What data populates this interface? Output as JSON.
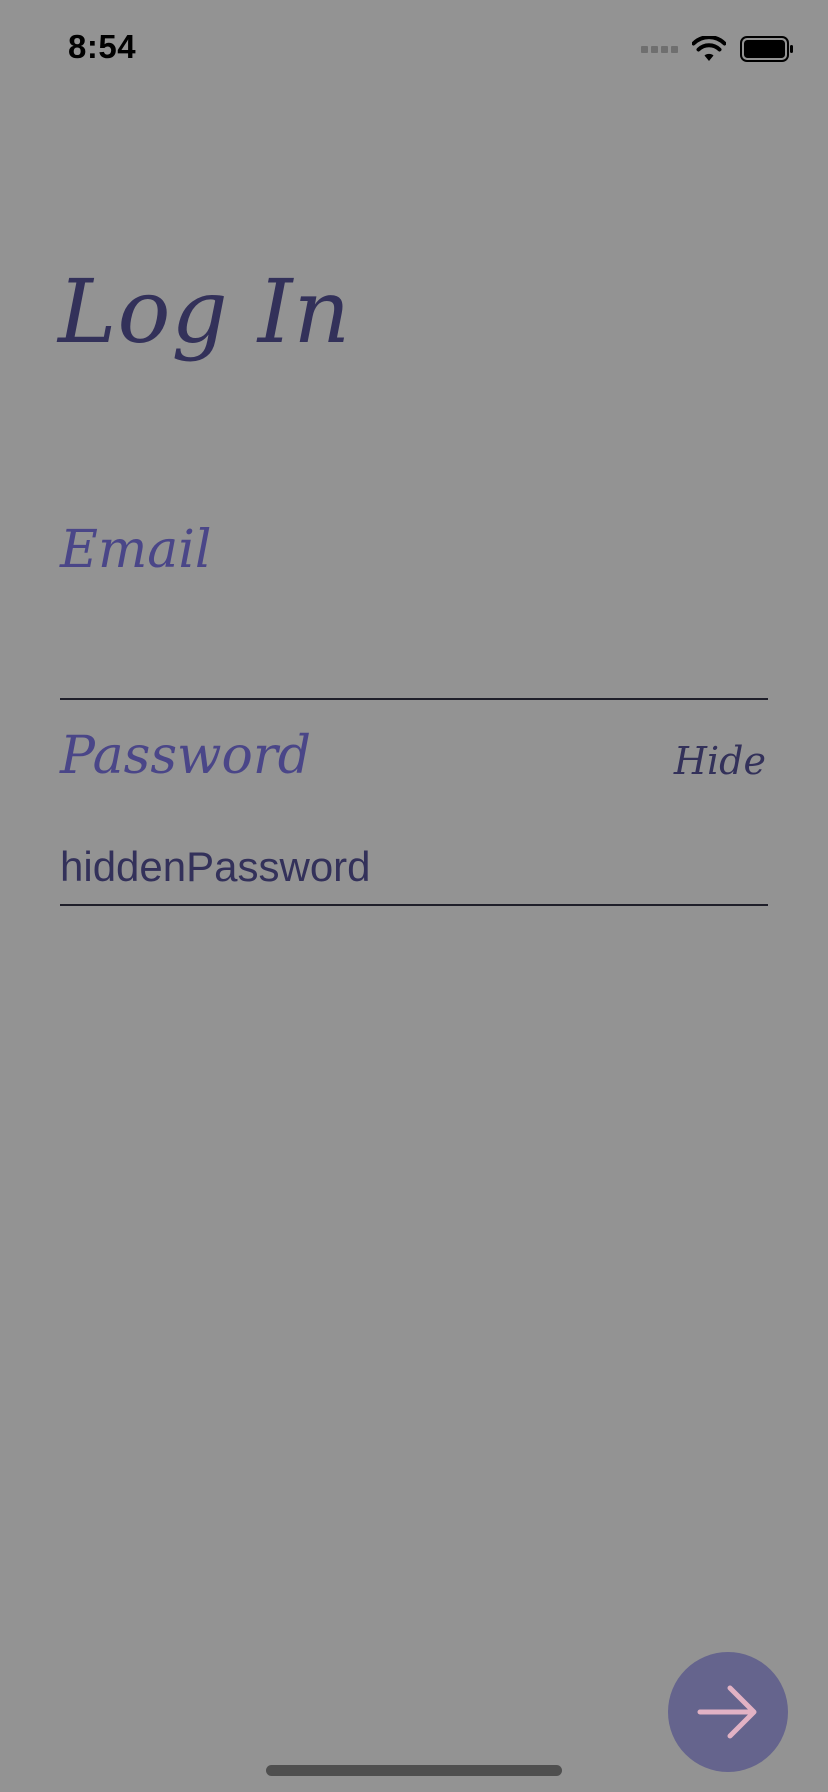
{
  "status_bar": {
    "time": "8:54",
    "icons": [
      "cellular-signal-icon",
      "wifi-icon",
      "battery-icon"
    ]
  },
  "screen": {
    "title": "Log In"
  },
  "form": {
    "email_label": "Email",
    "email_value": "",
    "password_label": "Password",
    "password_value": "hiddenPassword",
    "toggle_label": "Hide"
  },
  "actions": {
    "next_icon": "arrow-right-icon"
  },
  "colors": {
    "background": "#939393",
    "title": "#33315a",
    "label": "#4a4688",
    "button_fill": "#65648d",
    "arrow": "#e2b2c4"
  }
}
